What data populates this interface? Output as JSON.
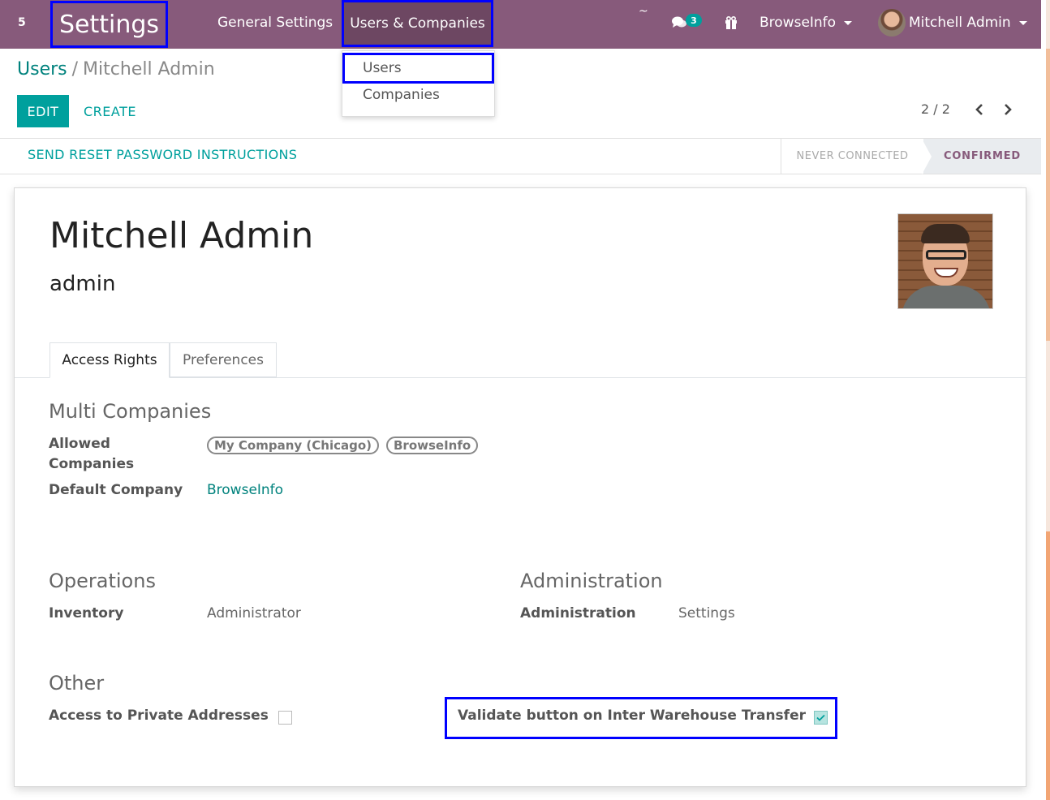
{
  "navbar": {
    "apps_badge": "5",
    "app_title": "Settings",
    "menus": [
      "General Settings",
      "Users & Companies"
    ],
    "tilde": "~",
    "chat_count": "3",
    "company": "BrowseInfo",
    "user": "Mitchell Admin",
    "color": "#875a7b"
  },
  "dropdown": {
    "items": [
      "Users",
      "Companies"
    ]
  },
  "breadcrumb": {
    "parent": "Users",
    "separator": "/",
    "current": "Mitchell Admin"
  },
  "buttons": {
    "edit": "EDIT",
    "create": "CREATE",
    "reset_password": "SEND RESET PASSWORD INSTRUCTIONS"
  },
  "pager": {
    "value": "2 / 2",
    "prev": "‹",
    "next": "›"
  },
  "status": {
    "stages": [
      "NEVER CONNECTED",
      "CONFIRMED"
    ],
    "active": "CONFIRMED"
  },
  "record": {
    "name": "Mitchell Admin",
    "login": "admin"
  },
  "tabs": [
    "Access Rights",
    "Preferences"
  ],
  "multi_companies": {
    "title": "Multi Companies",
    "allowed_label_1": "Allowed",
    "allowed_label_2": "Companies",
    "allowed": [
      "My Company (Chicago)",
      "BrowseInfo"
    ],
    "default_label": "Default Company",
    "default_value": "BrowseInfo"
  },
  "operations": {
    "title": "Operations",
    "inventory_label": "Inventory",
    "inventory_value": "Administrator"
  },
  "administration": {
    "title": "Administration",
    "admin_label": "Administration",
    "admin_value": "Settings"
  },
  "other": {
    "title": "Other",
    "private_label": "Access to Private Addresses",
    "private_checked": false,
    "validate_label": "Validate button on Inter Warehouse Transfer",
    "validate_checked": true
  },
  "colors": {
    "accent": "#00a09d",
    "link": "#00827d",
    "highlight": "#0000ff"
  }
}
